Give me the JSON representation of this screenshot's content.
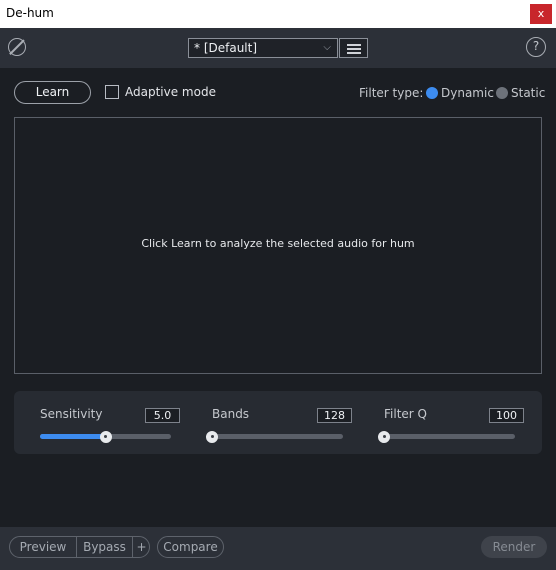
{
  "window": {
    "title": "De-hum",
    "close_label": "x"
  },
  "toolbar": {
    "preset_value": "* [Default]",
    "preset_chevron": "⌵",
    "help_label": "?"
  },
  "learn_label": "Learn",
  "adaptive_mode": {
    "label": "Adaptive mode",
    "checked": false
  },
  "filter_type": {
    "label": "Filter type:",
    "options": [
      "Dynamic",
      "Static"
    ],
    "selected": "Dynamic"
  },
  "display": {
    "message": "Click Learn to analyze the selected audio for hum"
  },
  "controls": [
    {
      "label": "Sensitivity",
      "value": "5.0",
      "level": 0.5
    },
    {
      "label": "Bands",
      "value": "128",
      "level": 0.0
    },
    {
      "label": "Filter Q",
      "value": "100",
      "level": 0.0
    }
  ],
  "bottom": {
    "preview_label": "Preview",
    "bypass_label": "Bypass",
    "plus_label": "+",
    "compare_label": "Compare",
    "render_label": "Render"
  },
  "colors": {
    "accent": "#3d8cf0",
    "close": "#c8262b",
    "background": "#1b1e23"
  }
}
